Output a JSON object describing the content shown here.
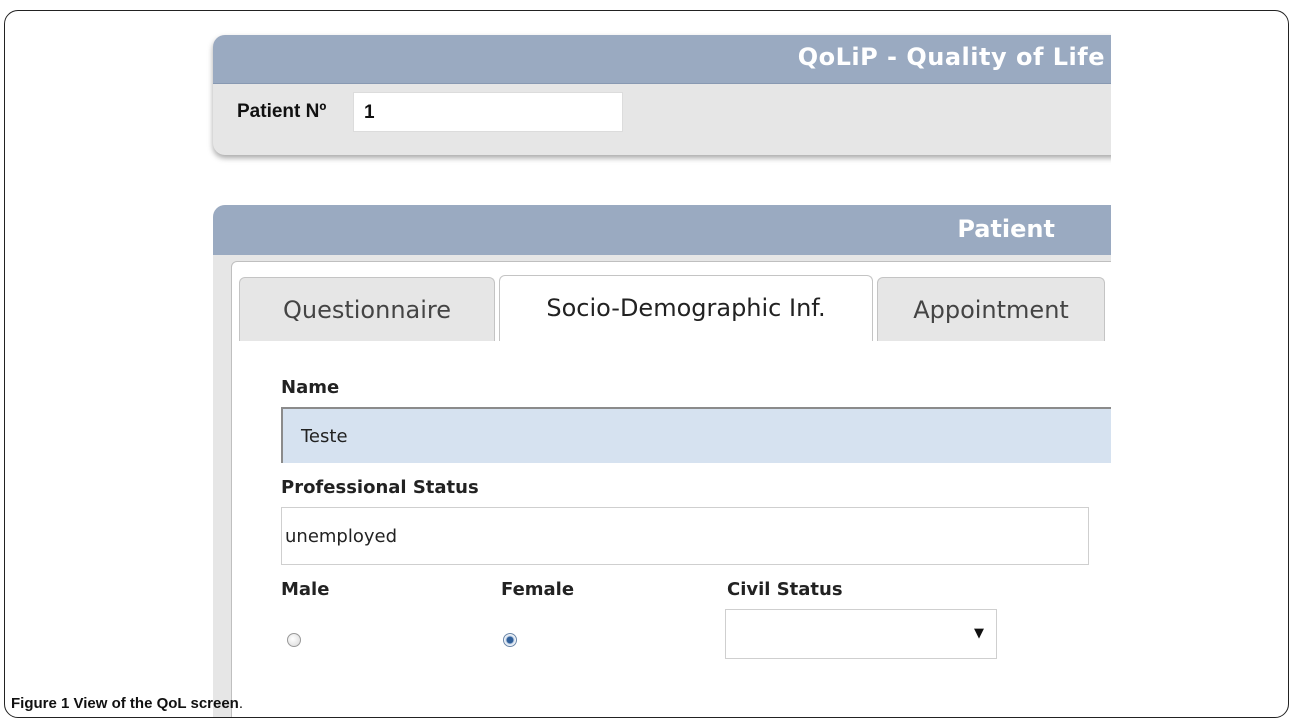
{
  "app": {
    "title": "QoLiP - Quality of Life"
  },
  "top_panel": {
    "patient_no_label": "Patient Nº",
    "patient_no_value": "1"
  },
  "patient_panel": {
    "title": "Patient",
    "tabs": [
      {
        "label": "Questionnaire",
        "active": false
      },
      {
        "label": "Socio-Demographic Inf.",
        "active": true
      },
      {
        "label": "Appointment",
        "active": false
      }
    ],
    "form": {
      "name_label": "Name",
      "name_value": "Teste",
      "professional_status_label": "Professional Status",
      "professional_status_value": "unemployed",
      "male_label": "Male",
      "female_label": "Female",
      "gender_selected": "Female",
      "civil_status_label": "Civil Status",
      "civil_status_value": ""
    }
  },
  "caption": {
    "prefix": "Figure 1 View of the QoL screen",
    "suffix": "."
  },
  "colors": {
    "header_blue": "#9aaac1",
    "panel_gray": "#e6e6e6",
    "name_field_bg": "#d6e2f0"
  }
}
